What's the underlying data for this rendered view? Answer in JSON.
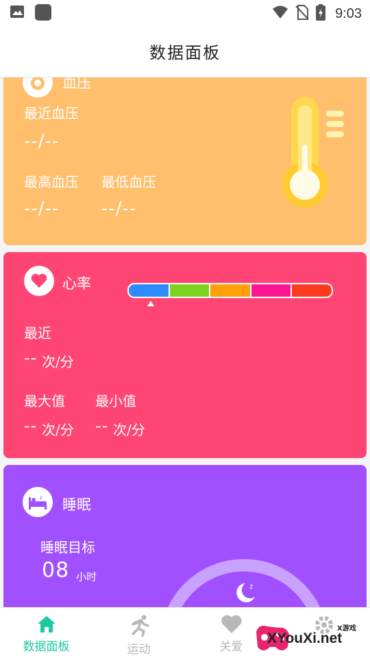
{
  "status_bar": {
    "time": "9:03"
  },
  "header": {
    "title": "数据面板"
  },
  "blood_pressure": {
    "title": "血压",
    "recent_label": "最近血压",
    "recent_value": "--/--",
    "max_label": "最高血压",
    "max_value": "--/--",
    "min_label": "最低血压",
    "min_value": "--/--"
  },
  "heart_rate": {
    "title": "心率",
    "recent_label": "最近",
    "recent_value": "--",
    "recent_unit": "次/分",
    "max_label": "最大值",
    "max_value": "--",
    "max_unit": "次/分",
    "min_label": "最小值",
    "min_value": "--",
    "min_unit": "次/分",
    "scale_colors": [
      "#2e8bff",
      "#7ed321",
      "#ff9f0a",
      "#ff1493",
      "#ff3b1f"
    ]
  },
  "sleep": {
    "title": "睡眠",
    "goal_label": "睡眠目标",
    "goal_value": "08",
    "goal_unit": "小时"
  },
  "bottom_nav": {
    "items": [
      {
        "label": "数据面板",
        "icon": "home-icon",
        "active": true
      },
      {
        "label": "运动",
        "icon": "runner-icon",
        "active": false
      },
      {
        "label": "关爱",
        "icon": "heart-icon",
        "active": false
      },
      {
        "label": "设置",
        "icon": "gear-icon",
        "active": false
      }
    ]
  },
  "watermark": {
    "text": "XYouXi.net",
    "small": "X游戏"
  },
  "colors": {
    "bp_card": "#ffbf6d",
    "hr_card": "#ff4574",
    "sleep_card": "#a150ff",
    "nav_active": "#1ec8a5",
    "nav_inactive": "#b8b8b8"
  }
}
